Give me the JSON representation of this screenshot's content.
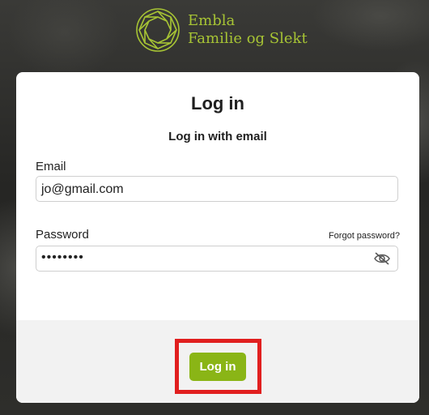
{
  "brand": {
    "line1": "Embla",
    "line2": "Familie og Slekt",
    "logo_icon": "embla-diamond-logo-icon",
    "color": "#a7c434"
  },
  "login": {
    "title": "Log in",
    "subtitle": "Log in with email",
    "email_label": "Email",
    "email_value": "jo@gmail.com",
    "password_label": "Password",
    "forgot_password": "Forgot password?",
    "password_masked": "••••••••",
    "toggle_visibility_icon": "eye-slash-icon",
    "submit_label": "Log in",
    "accent_color": "#8ab516",
    "highlight_color": "#e11f1f"
  }
}
